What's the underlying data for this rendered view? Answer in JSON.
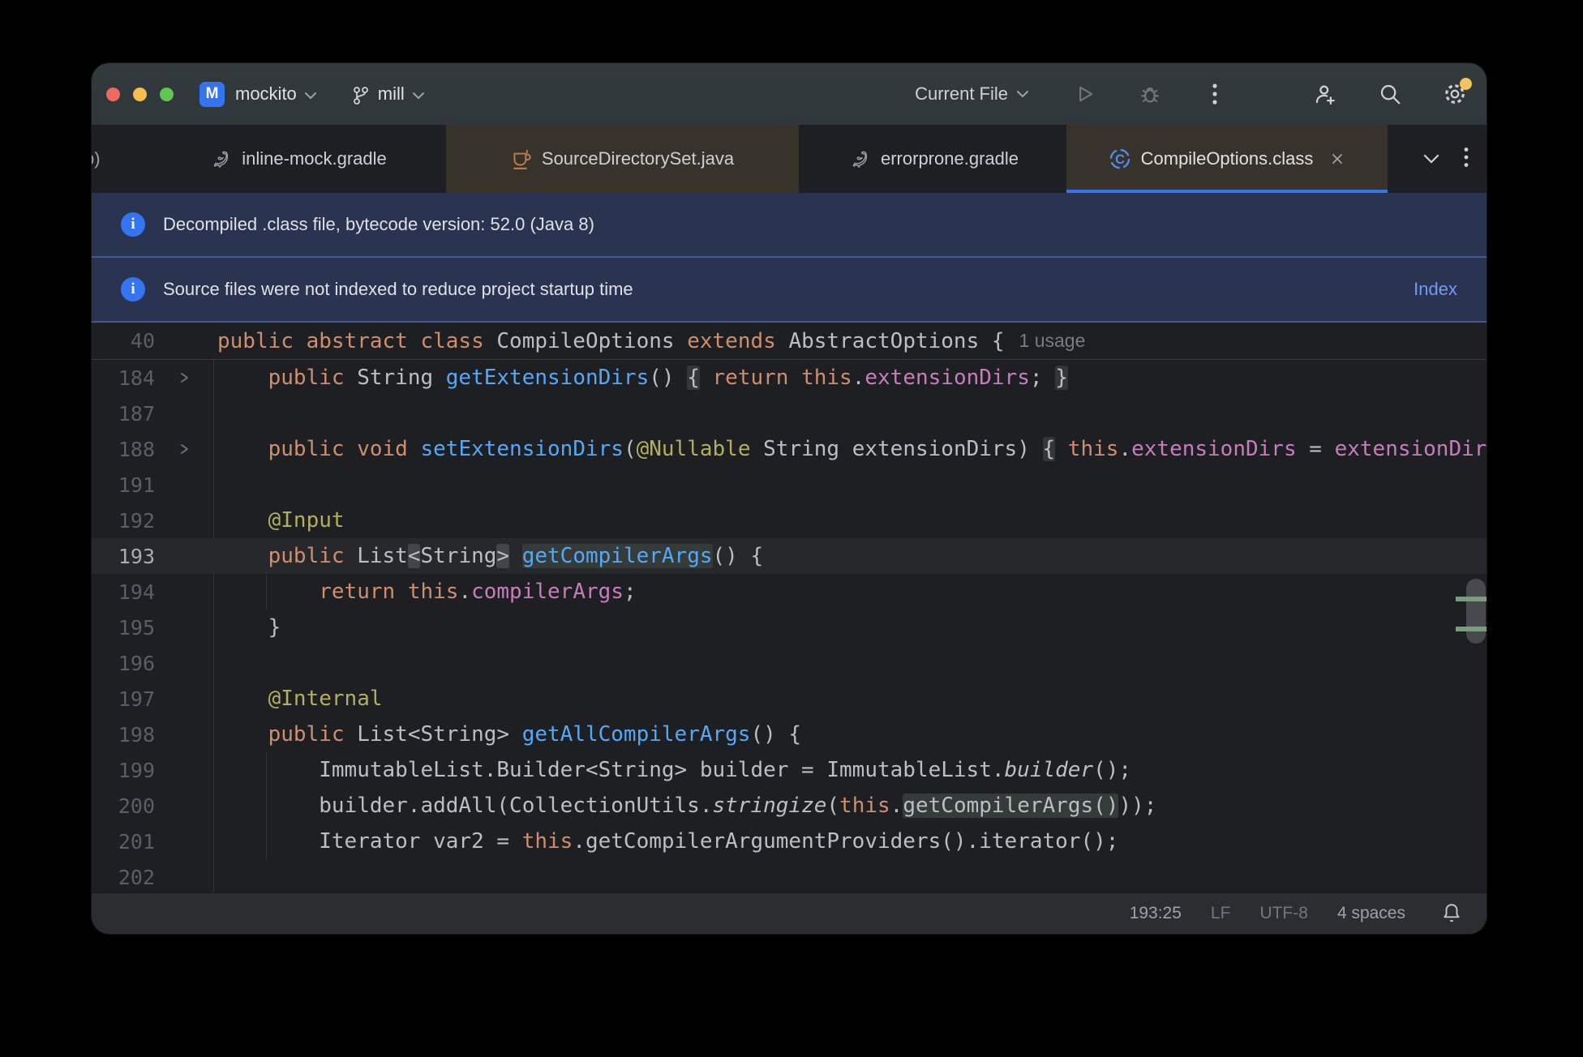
{
  "titlebar": {
    "badge": "M",
    "project": "mockito",
    "branch": "mill",
    "run_config": "Current File"
  },
  "tabs": [
    {
      "label": "b)",
      "icon": "none",
      "clipped": true
    },
    {
      "label": "inline-mock.gradle",
      "icon": "gradle"
    },
    {
      "label": "SourceDirectorySet.java",
      "icon": "java",
      "tinted": true
    },
    {
      "label": "errorprone.gradle",
      "icon": "gradle"
    },
    {
      "label": "CompileOptions.class",
      "icon": "class",
      "tinted": true,
      "active": true,
      "closable": true
    }
  ],
  "banners": [
    {
      "text": "Decompiled .class file, bytecode version: 52.0 (Java 8)",
      "action": ""
    },
    {
      "text": "Source files were not indexed to reduce project startup time",
      "action": "Index"
    }
  ],
  "sticky": {
    "num": "40",
    "hint": "1 usage",
    "tokens": [
      {
        "t": "public ",
        "c": "k"
      },
      {
        "t": "abstract ",
        "c": "k"
      },
      {
        "t": "class ",
        "c": "k"
      },
      {
        "t": "CompileOptions ",
        "c": "d"
      },
      {
        "t": "extends ",
        "c": "k"
      },
      {
        "t": "AbstractOptions ",
        "c": "d"
      },
      {
        "t": "{",
        "c": "d"
      }
    ]
  },
  "code_lines": [
    {
      "num": "184",
      "arrow": true,
      "tokens": [
        {
          "t": "    ",
          "c": "d"
        },
        {
          "t": "public ",
          "c": "k"
        },
        {
          "t": "String ",
          "c": "d"
        },
        {
          "t": "getExtensionDirs",
          "c": "m"
        },
        {
          "t": "() ",
          "c": "d"
        },
        {
          "t": "{",
          "c": "d",
          "bg": "fold"
        },
        {
          "t": " ",
          "c": "d"
        },
        {
          "t": "return ",
          "c": "k"
        },
        {
          "t": "this",
          "c": "k"
        },
        {
          "t": ".",
          "c": "d"
        },
        {
          "t": "extensionDirs",
          "c": "f"
        },
        {
          "t": "; ",
          "c": "d"
        },
        {
          "t": "}",
          "c": "d",
          "bg": "fold"
        }
      ]
    },
    {
      "num": "187",
      "tokens": []
    },
    {
      "num": "188",
      "arrow": true,
      "tokens": [
        {
          "t": "    ",
          "c": "d"
        },
        {
          "t": "public ",
          "c": "k"
        },
        {
          "t": "void ",
          "c": "k"
        },
        {
          "t": "setExtensionDirs",
          "c": "m"
        },
        {
          "t": "(",
          "c": "d"
        },
        {
          "t": "@Nullable",
          "c": "a"
        },
        {
          "t": " String extensionDirs) ",
          "c": "d"
        },
        {
          "t": "{",
          "c": "d",
          "bg": "fold"
        },
        {
          "t": " ",
          "c": "d"
        },
        {
          "t": "this",
          "c": "k"
        },
        {
          "t": ".",
          "c": "d"
        },
        {
          "t": "extensionDirs",
          "c": "f"
        },
        {
          "t": " = ",
          "c": "d"
        },
        {
          "t": "extensionDirs",
          "c": "f"
        }
      ]
    },
    {
      "num": "191",
      "tokens": []
    },
    {
      "num": "192",
      "tokens": [
        {
          "t": "    ",
          "c": "d"
        },
        {
          "t": "@Input",
          "c": "a"
        }
      ]
    },
    {
      "num": "193",
      "current": true,
      "tokens": [
        {
          "t": "    ",
          "c": "d"
        },
        {
          "t": "public ",
          "c": "k"
        },
        {
          "t": "List",
          "c": "d"
        },
        {
          "t": "<",
          "c": "d",
          "bg": "brace"
        },
        {
          "t": "String",
          "c": "d"
        },
        {
          "t": ">",
          "c": "d",
          "bg": "brace"
        },
        {
          "t": " ",
          "c": "d"
        },
        {
          "t": "getCompilerArgs",
          "c": "m",
          "bg": "hl"
        },
        {
          "t": "() {",
          "c": "d"
        }
      ]
    },
    {
      "num": "194",
      "guide": true,
      "tokens": [
        {
          "t": "        ",
          "c": "d"
        },
        {
          "t": "return ",
          "c": "k"
        },
        {
          "t": "this",
          "c": "k"
        },
        {
          "t": ".",
          "c": "d"
        },
        {
          "t": "compilerArgs",
          "c": "f"
        },
        {
          "t": ";",
          "c": "d"
        }
      ]
    },
    {
      "num": "195",
      "tokens": [
        {
          "t": "    }",
          "c": "d"
        }
      ]
    },
    {
      "num": "196",
      "tokens": []
    },
    {
      "num": "197",
      "tokens": [
        {
          "t": "    ",
          "c": "d"
        },
        {
          "t": "@Internal",
          "c": "a"
        }
      ]
    },
    {
      "num": "198",
      "tokens": [
        {
          "t": "    ",
          "c": "d"
        },
        {
          "t": "public ",
          "c": "k"
        },
        {
          "t": "List<String> ",
          "c": "d"
        },
        {
          "t": "getAllCompilerArgs",
          "c": "m"
        },
        {
          "t": "() {",
          "c": "d"
        }
      ]
    },
    {
      "num": "199",
      "guide": true,
      "tokens": [
        {
          "t": "        ",
          "c": "d"
        },
        {
          "t": "ImmutableList.Builder<String> builder = ImmutableList.",
          "c": "d"
        },
        {
          "t": "builder",
          "c": "d",
          "i": true
        },
        {
          "t": "();",
          "c": "d"
        }
      ]
    },
    {
      "num": "200",
      "guide": true,
      "tokens": [
        {
          "t": "        ",
          "c": "d"
        },
        {
          "t": "builder.addAll(CollectionUtils.",
          "c": "d"
        },
        {
          "t": "stringize",
          "c": "d",
          "i": true
        },
        {
          "t": "(",
          "c": "d"
        },
        {
          "t": "this",
          "c": "k"
        },
        {
          "t": ".",
          "c": "d"
        },
        {
          "t": "getCompilerArgs()",
          "c": "d",
          "bg": "hl"
        },
        {
          "t": "));",
          "c": "d"
        }
      ]
    },
    {
      "num": "201",
      "guide": true,
      "tokens": [
        {
          "t": "        ",
          "c": "d"
        },
        {
          "t": "Iterator var2 = ",
          "c": "d"
        },
        {
          "t": "this",
          "c": "k"
        },
        {
          "t": ".getCompilerArgumentProviders().iterator();",
          "c": "d"
        }
      ]
    },
    {
      "num": "202",
      "tokens": []
    }
  ],
  "statusbar": {
    "caret": "193:25",
    "line_ending": "LF",
    "encoding": "UTF-8",
    "indent": "4 spaces"
  },
  "colors": {
    "accent_blue": "#3574F0",
    "banner_bg": "#2A3450",
    "banner_border": "#41599A",
    "banner_link": "#6E9BF5",
    "editor_bg": "#1E1F22",
    "current_line_bg": "#26282B",
    "keyword": "#CF8E6D",
    "method": "#56A8F5",
    "field": "#C77DBB",
    "annotation": "#B3AE60",
    "default_text": "#BCBEC4",
    "tab_tinted_bg": "#37322A",
    "gear_badge": "#F2C55C",
    "traffic_red": "#EC6A5E",
    "traffic_yellow": "#F4BF4F",
    "traffic_green": "#61C554",
    "vcs_mark_green": "#7A9B7E"
  }
}
